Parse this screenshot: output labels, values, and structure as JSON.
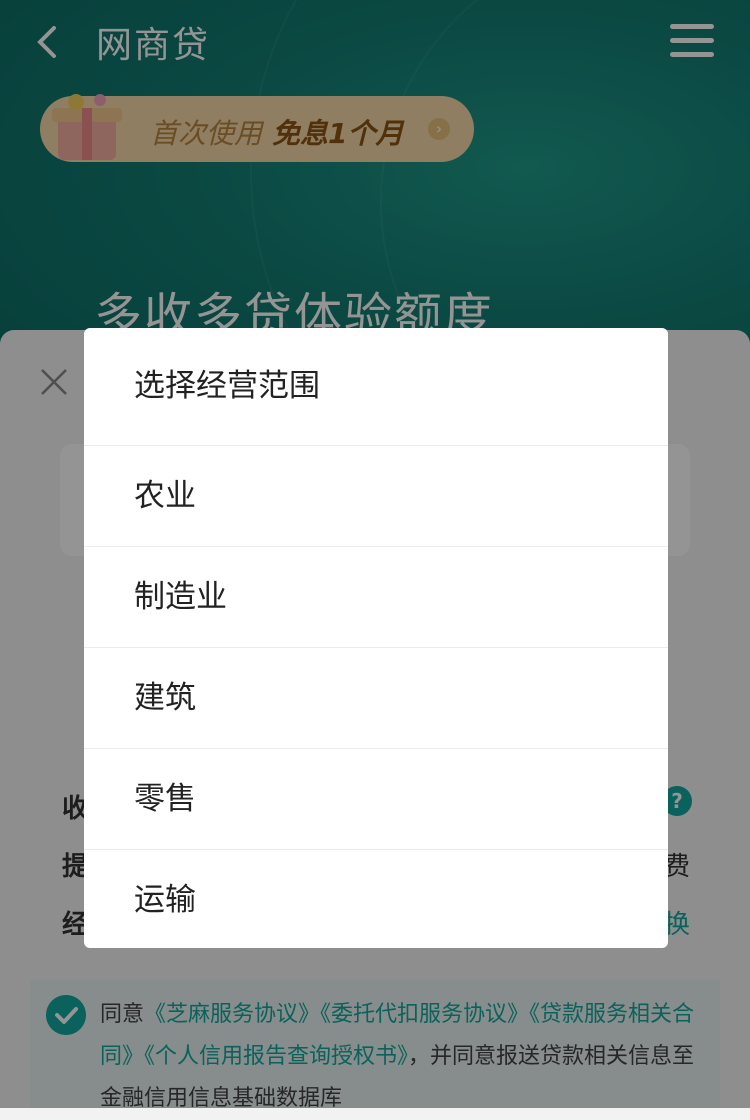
{
  "header": {
    "title": "网商贷"
  },
  "promo": {
    "label": "首次使用",
    "highlight": "免息1个月"
  },
  "hero": {
    "title": "多收多贷体验额度"
  },
  "background_rows": [
    {
      "label": "收",
      "right": ""
    },
    {
      "label": "提",
      "right": "费"
    },
    {
      "label": "经",
      "right": "换"
    }
  ],
  "agreement": {
    "prefix": "同意",
    "links": [
      "《芝麻服务协议》",
      "《委托代扣服务协议》",
      "《贷款服务相关合同》",
      "《个人信用报告查询授权书》"
    ],
    "suffix": "，并同意报送贷款相关信息至金融信用信息基础数据库"
  },
  "picker": {
    "title": "选择经营范围",
    "options": [
      "农业",
      "制造业",
      "建筑",
      "零售",
      "运输"
    ]
  },
  "colors": {
    "brand": "#13a89e",
    "hero_bg": "#137d73"
  }
}
